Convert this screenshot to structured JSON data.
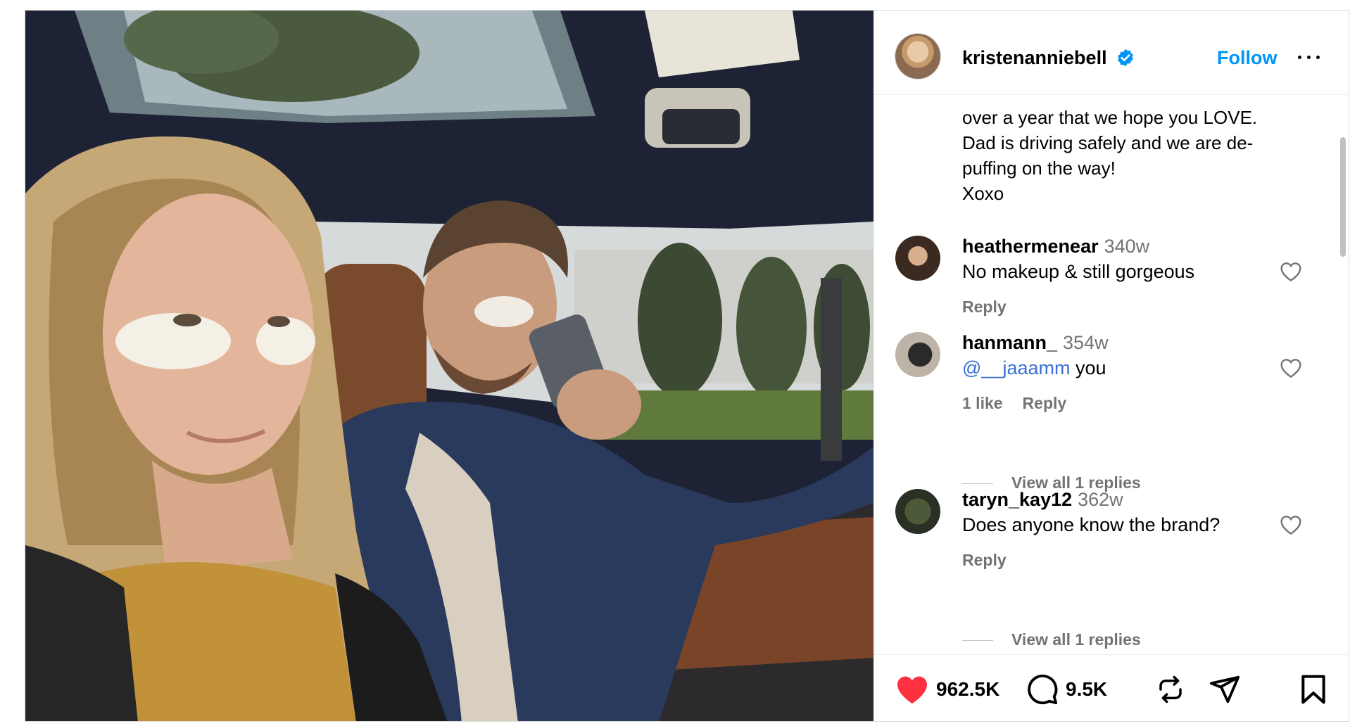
{
  "header": {
    "username": "kristenanniebell",
    "follow_label": "Follow"
  },
  "caption": {
    "lines": [
      "over a year that we hope you LOVE.",
      "Dad is driving safely and we are de-",
      "puffing on the way!",
      "Xoxo"
    ]
  },
  "comments": [
    {
      "username": "heathermenear",
      "time": "340w",
      "text": "No makeup & still gorgeous",
      "reply_label": "Reply"
    },
    {
      "username": "hanmann_",
      "time": "354w",
      "mention": "@__jaaamm",
      "text": " you",
      "likes": "1 like",
      "reply_label": "Reply",
      "view_replies": "View all 1 replies"
    },
    {
      "username": "taryn_kay12",
      "time": "362w",
      "text": "Does anyone know the brand?",
      "reply_label": "Reply",
      "view_replies": "View all 1 replies"
    }
  ],
  "actions": {
    "likes": "962.5K",
    "comments": "9.5K"
  },
  "colors": {
    "link_blue": "#0095f6",
    "like_red": "#ff3040",
    "secondary_text": "#737373"
  },
  "icons": [
    "verified-badge-icon",
    "more-options-icon",
    "heart-outline-icon",
    "heart-filled-icon",
    "comment-icon",
    "repost-icon",
    "share-icon",
    "bookmark-icon"
  ]
}
